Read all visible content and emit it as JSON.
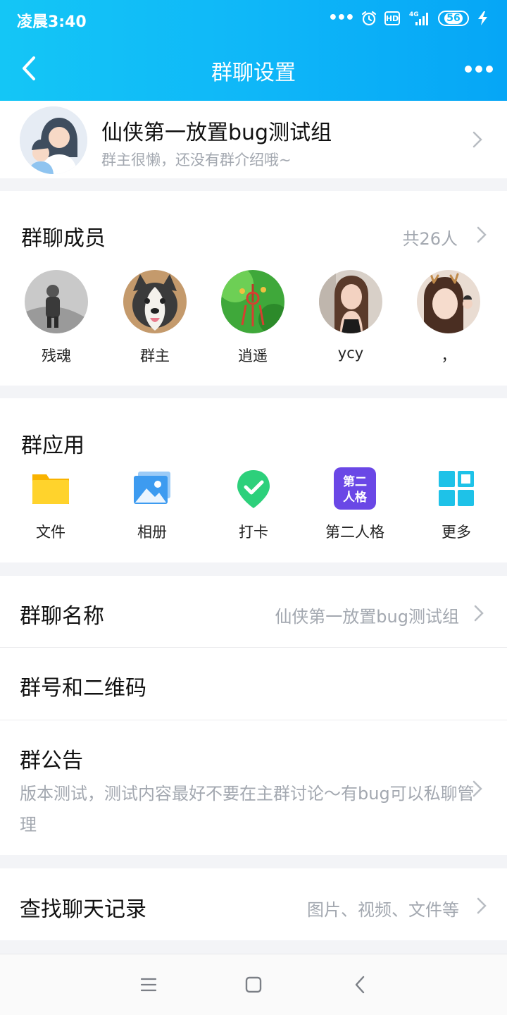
{
  "status_bar": {
    "time": "凌晨3:40",
    "signal_label": "4G",
    "hd_label": "HD",
    "battery": "56"
  },
  "nav": {
    "title": "群聊设置"
  },
  "group": {
    "name": "仙侠第一放置bug测试组",
    "intro": "群主很懒，还没有群介绍哦~"
  },
  "members": {
    "title": "群聊成员",
    "count": "共26人",
    "list": [
      {
        "name": "残魂",
        "avatar": "grayscale-photo-avatar"
      },
      {
        "name": "群主",
        "avatar": "husky-dog-avatar"
      },
      {
        "name": "逍遥",
        "avatar": "green-leaf-ornament-avatar"
      },
      {
        "name": "ycy",
        "avatar": "woman-selfie-avatar"
      },
      {
        "name": "，",
        "avatar": "girl-with-antlers-avatar"
      }
    ]
  },
  "apps": {
    "title": "群应用",
    "list": [
      {
        "label": "文件",
        "icon": "folder-icon"
      },
      {
        "label": "相册",
        "icon": "album-icon"
      },
      {
        "label": "打卡",
        "icon": "checkin-icon"
      },
      {
        "label": "第二人格",
        "icon": "second-persona-icon",
        "badge_line1": "第二",
        "badge_line2": "人格"
      },
      {
        "label": "更多",
        "icon": "grid-more-icon"
      }
    ]
  },
  "settings": {
    "group_name": {
      "label": "群聊名称",
      "value": "仙侠第一放置bug测试组"
    },
    "qr": {
      "label": "群号和二维码"
    },
    "notice": {
      "label": "群公告",
      "text": "版本测试，测试内容最好不要在主群讨论～有bug可以私聊管理"
    },
    "search": {
      "label": "查找聊天记录",
      "value": "图片、视频、文件等"
    }
  },
  "colors": {
    "header_start": "#14c6f6",
    "header_end": "#06a6f6",
    "muted_text": "#a3a8b0",
    "page_bg": "#f3f4f7"
  }
}
